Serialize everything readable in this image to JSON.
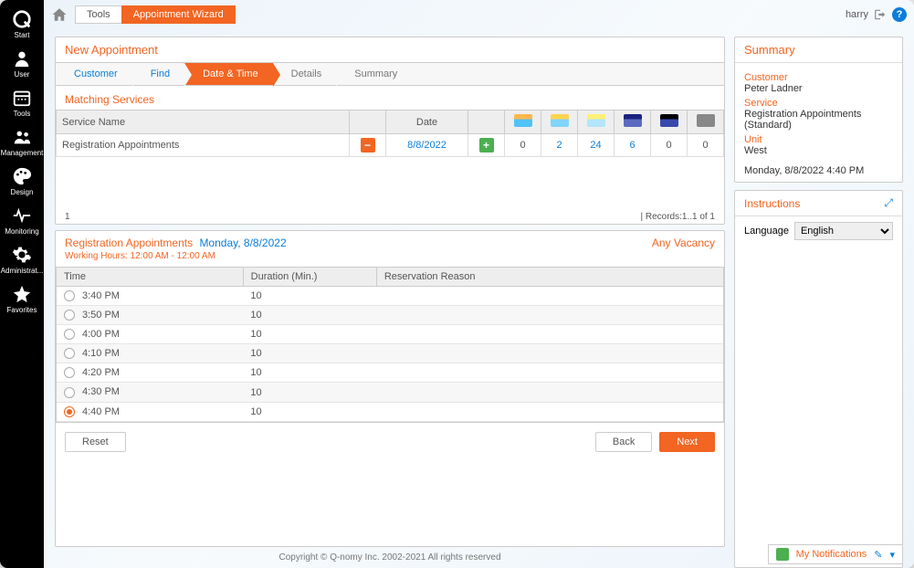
{
  "sidebar": [
    {
      "label": "Start",
      "name": "sidebar-start"
    },
    {
      "label": "User",
      "name": "sidebar-user"
    },
    {
      "label": "Tools",
      "name": "sidebar-tools"
    },
    {
      "label": "Management",
      "name": "sidebar-management"
    },
    {
      "label": "Design",
      "name": "sidebar-design"
    },
    {
      "label": "Monitoring",
      "name": "sidebar-monitoring"
    },
    {
      "label": "Administrat...",
      "name": "sidebar-admin"
    },
    {
      "label": "Favorites",
      "name": "sidebar-favorites"
    }
  ],
  "breadcrumb": {
    "tools": "Tools",
    "wizard": "Appointment Wizard"
  },
  "user_name": "harry",
  "page_title": "New Appointment",
  "steps": {
    "customer": "Customer",
    "find": "Find",
    "datetime": "Date & Time",
    "details": "Details",
    "summary": "Summary"
  },
  "matching": {
    "title": "Matching Services",
    "headers": {
      "service": "Service Name",
      "date": "Date"
    },
    "row": {
      "service": "Registration Appointments",
      "date": "8/8/2022",
      "counts": [
        "0",
        "2",
        "24",
        "6",
        "0",
        "0"
      ]
    },
    "records": "| Records:1..1 of 1",
    "row_index": "1"
  },
  "slots": {
    "service": "Registration Appointments",
    "date": "Monday, 8/8/2022",
    "hours": "Working Hours: 12:00 AM - 12:00 AM",
    "vacancy": "Any Vacancy",
    "headers": {
      "time": "Time",
      "duration": "Duration (Min.)",
      "reason": "Reservation Reason"
    },
    "rows": [
      {
        "time": "3:40 PM",
        "dur": "10",
        "sel": false
      },
      {
        "time": "3:50 PM",
        "dur": "10",
        "sel": false
      },
      {
        "time": "4:00 PM",
        "dur": "10",
        "sel": false
      },
      {
        "time": "4:10 PM",
        "dur": "10",
        "sel": false
      },
      {
        "time": "4:20 PM",
        "dur": "10",
        "sel": false
      },
      {
        "time": "4:30 PM",
        "dur": "10",
        "sel": false
      },
      {
        "time": "4:40 PM",
        "dur": "10",
        "sel": true
      }
    ]
  },
  "buttons": {
    "reset": "Reset",
    "back": "Back",
    "next": "Next"
  },
  "summary": {
    "title": "Summary",
    "customer_label": "Customer",
    "customer": "Peter Ladner",
    "service_label": "Service",
    "service": "Registration Appointments  (Standard)",
    "unit_label": "Unit",
    "unit": "West",
    "datetime": "Monday, 8/8/2022  4:40 PM"
  },
  "instructions": {
    "title": "Instructions",
    "language_label": "Language",
    "language": "English"
  },
  "footer": "Copyright © Q-nomy Inc. 2002-2021 All rights reserved",
  "notifications": {
    "title": "My Notifications"
  }
}
